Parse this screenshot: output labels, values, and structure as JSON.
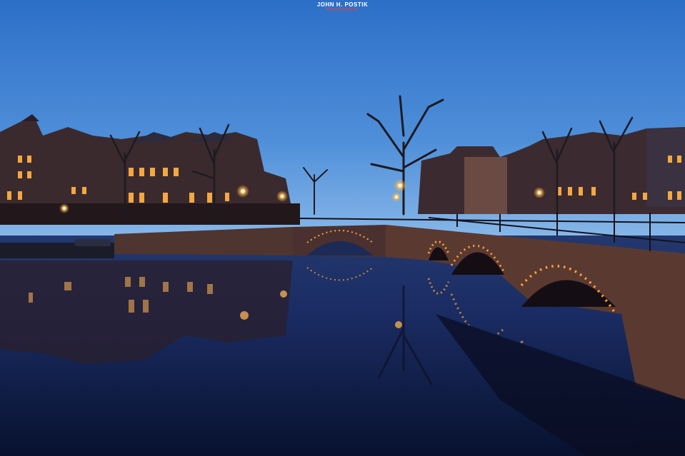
{
  "watermark": {
    "name": "JOHN H. POSTIK",
    "subtitle": "PHOTOGRAPHY"
  },
  "colors": {
    "sky_top": "#2f72c9",
    "sky_horizon": "#7fb2e8",
    "water_deep": "#0a1436",
    "lamp_glow": "#ffb347",
    "window_light": "#f5a742",
    "brick": "#5a3a30"
  }
}
